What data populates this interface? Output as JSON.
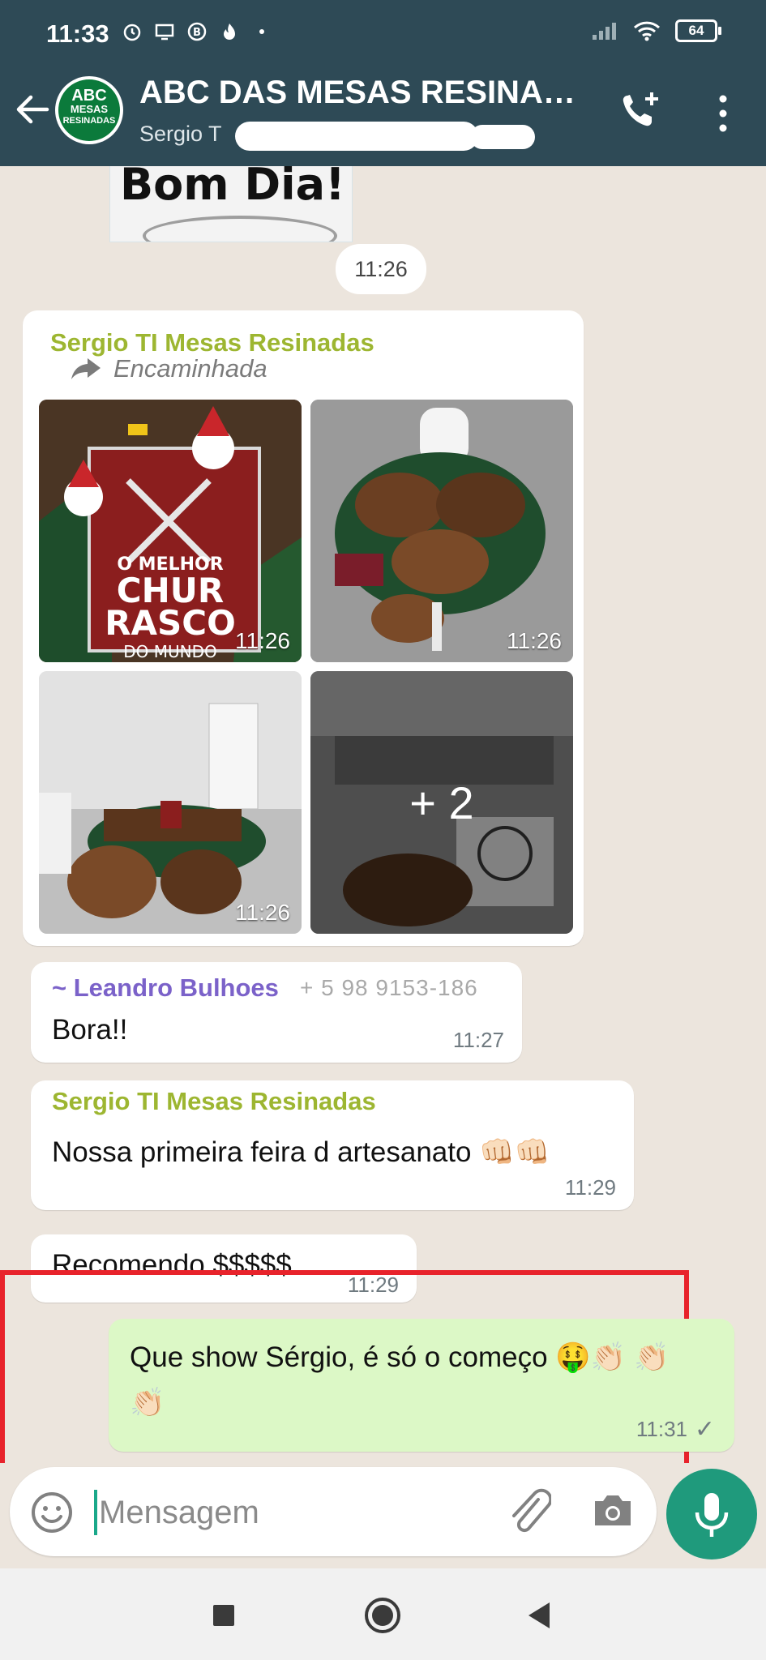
{
  "status_bar": {
    "time": "11:33",
    "battery": "64",
    "icons": [
      "alarm-icon",
      "screen-icon",
      "b-badge-icon",
      "flame-icon",
      "dot-icon",
      "signal-icon",
      "wifi-icon",
      "battery-icon"
    ]
  },
  "header": {
    "title": "ABC DAS MESAS RESINAD...",
    "subtitle": "Sergio T                                 11 ...",
    "avatar_lines": [
      "ABC",
      "MESAS",
      "RESINADAS"
    ]
  },
  "messages": {
    "image_top": {
      "text": "Bom  Dia!"
    },
    "date_chip": "11:26",
    "album": {
      "sender": "Sergio TI Mesas Resinadas",
      "forwarded_label": "Encaminhada",
      "tiles": [
        {
          "time": "11:26"
        },
        {
          "time": "11:26"
        },
        {
          "time": "11:26"
        },
        {
          "more": "+ 2"
        }
      ],
      "sign_text": [
        "O MELHOR",
        "CHUR",
        "RASCO",
        "DO MUNDO"
      ]
    },
    "reply1": {
      "sender": "~ Leandro Bulhoes",
      "phone": "+ 5 98 9153-186",
      "text": "Bora!!",
      "time": "11:27"
    },
    "reply2": {
      "sender": "Sergio TI Mesas Resinadas",
      "text": "Nossa primeira feira d artesanato 👊🏻👊🏻",
      "time": "11:29"
    },
    "reply3": {
      "text": "Recomendo $$$$$",
      "time": "11:29"
    },
    "outgoing": {
      "text": "Que show Sérgio, é só o começo 🤑👏🏻 👏🏻👏🏻",
      "time": "11:31",
      "status": "✓"
    }
  },
  "composer": {
    "placeholder": "Mensagem"
  },
  "colors": {
    "header_bg": "#2e4a56",
    "chat_bg": "#ece5dd",
    "outgoing_bubble": "#dcf8c6",
    "sender_green": "#9db631",
    "sender_purple": "#7b62c9",
    "fab_green": "#1f9a7c",
    "highlight_red": "#e8232b"
  }
}
